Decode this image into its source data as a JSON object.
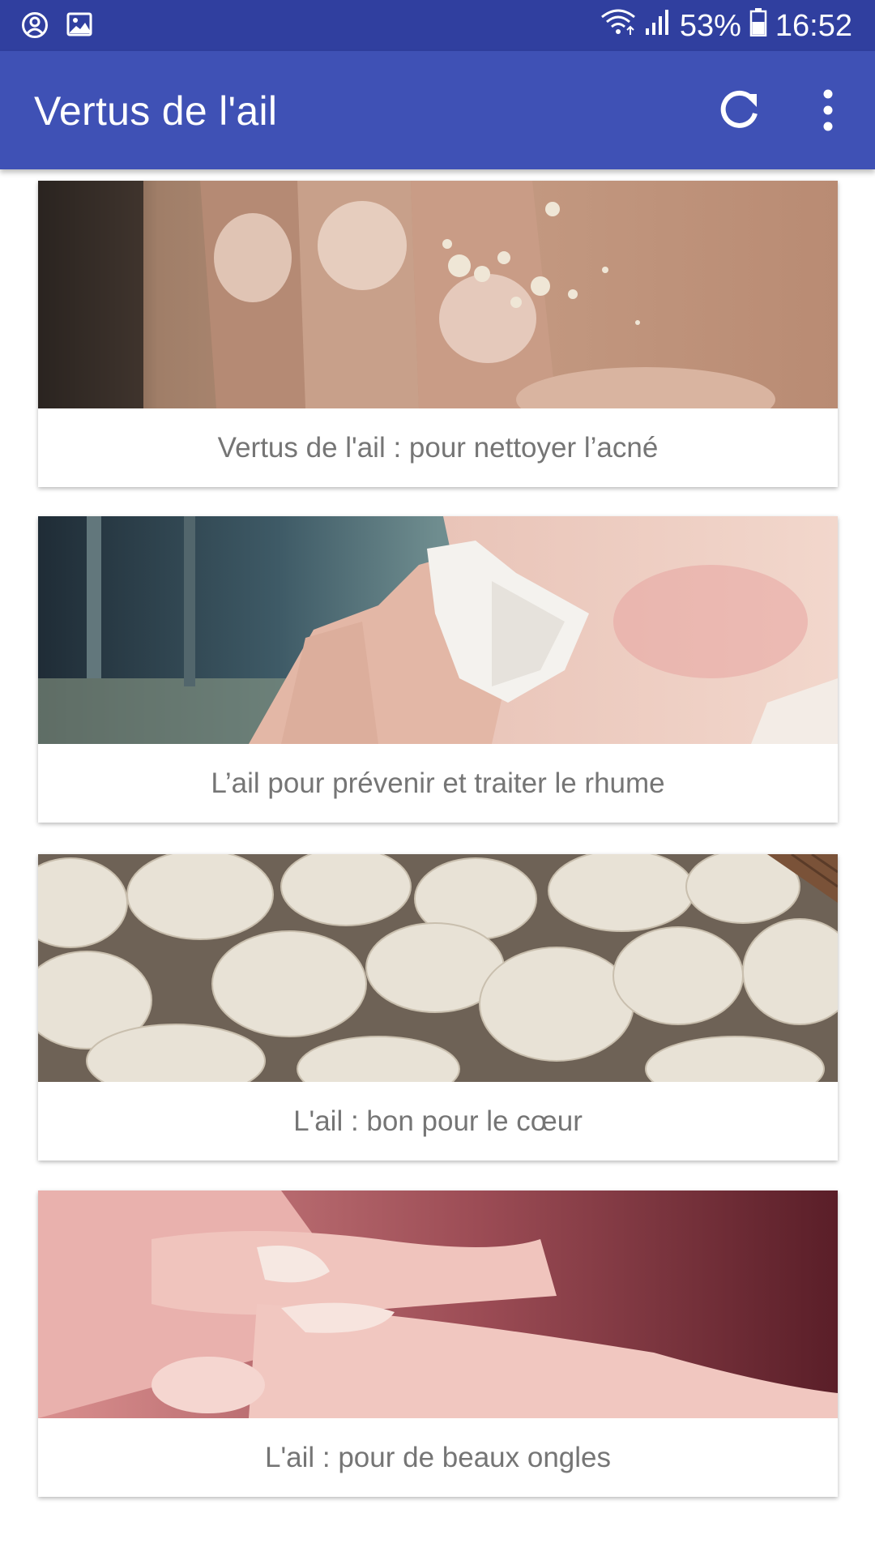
{
  "status_bar": {
    "battery": "53%",
    "time": "16:52",
    "icons": [
      "account-circle-icon",
      "image-icon",
      "wifi-icon",
      "signal-icon",
      "battery-icon"
    ]
  },
  "app_bar": {
    "title": "Vertus de l'ail",
    "actions": [
      "refresh-icon",
      "more-vert-icon"
    ]
  },
  "colors": {
    "status_bar": "#303f9f",
    "app_bar": "#3f51b5",
    "card_title": "#757575"
  },
  "articles": [
    {
      "title": "Vertus de l'ail : pour nettoyer l’acné",
      "image": "acne-fingers-photo"
    },
    {
      "title": "L’ail pour prévenir et traiter le rhume",
      "image": "woman-nose-tissue-photo"
    },
    {
      "title": "L'ail : bon pour le cœur",
      "image": "garlic-bulbs-photo"
    },
    {
      "title": "L'ail : pour de beaux ongles",
      "image": "fingernail-closeup-photo"
    }
  ]
}
